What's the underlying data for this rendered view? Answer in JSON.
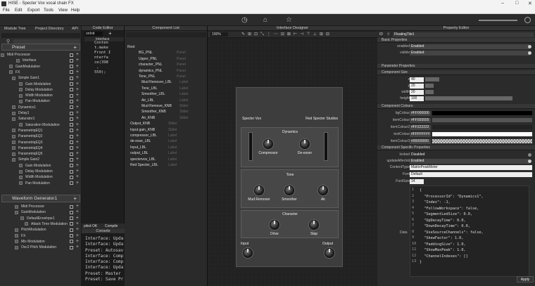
{
  "window": {
    "title": "HISE - Specter Vox vocal chain FX"
  },
  "menu": [
    "File",
    "Edit",
    "Export",
    "Tools",
    "View",
    "Help"
  ],
  "left": {
    "tabs": [
      "Module Tree",
      "Project Directory",
      "API"
    ],
    "preset_label": "Preset",
    "rows": [
      {
        "label": "Midi Processor",
        "indent": 10
      },
      {
        "label": "Interface",
        "indent": 32
      },
      {
        "label": "GainModulation",
        "indent": 22
      },
      {
        "label": "FX",
        "indent": 22
      },
      {
        "label": "Simple Gain1",
        "indent": 26
      },
      {
        "label": "Gain Modulation",
        "indent": 36
      },
      {
        "label": "Delay Modulation",
        "indent": 36
      },
      {
        "label": "Width Modulation",
        "indent": 36
      },
      {
        "label": "Pan Modulation",
        "indent": 36
      },
      {
        "label": "Dynamics1",
        "indent": 26
      },
      {
        "label": "Delay1",
        "indent": 26
      },
      {
        "label": "Saturator1",
        "indent": 26
      },
      {
        "label": "Saturation Modulation",
        "indent": 36
      },
      {
        "label": "ParametriqEQ1",
        "indent": 26
      },
      {
        "label": "ParametriqEQ2",
        "indent": 26
      },
      {
        "label": "ParametriqEQ3",
        "indent": 26
      },
      {
        "label": "ParametriqEQ4",
        "indent": 26
      },
      {
        "label": "ParametriqEQ5",
        "indent": 26
      },
      {
        "label": "Simple Gain2",
        "indent": 26
      },
      {
        "label": "Gain Modulation",
        "indent": 36
      },
      {
        "label": "Delay Modulation",
        "indent": 36
      },
      {
        "label": "Width Modulation",
        "indent": 36
      },
      {
        "label": "Pan Modulation",
        "indent": 36
      }
    ],
    "waveform_label": "Waveform Generator1",
    "rows2": [
      {
        "label": "Midi Processor",
        "indent": 30
      },
      {
        "label": "GainModulation",
        "indent": 30
      },
      {
        "label": "DefaultEnvelope1",
        "indent": 38
      },
      {
        "label": "Attack Time Modulation",
        "indent": 44
      },
      {
        "label": "PitchModulation",
        "indent": 30
      },
      {
        "label": "FX",
        "indent": 30
      },
      {
        "label": "Mix Modulation",
        "indent": 30
      },
      {
        "label": "Osc2 Pitch Modulation",
        "indent": 30
      }
    ]
  },
  "code": {
    "header": "Code Editor",
    "tab": "onInit",
    "file": "Interface",
    "lines": [
      "Conten",
      "t.make",
      "Front I",
      "nterfa",
      "ce(398",
      " , ",
      "550);"
    ],
    "status": "piled OK",
    "compile": "Compile"
  },
  "console": {
    "header": "Console",
    "lines": [
      "Interface: Upda",
      "Interface: Upda",
      "Preset: Autosav",
      "Interface: Comp",
      "Interface: Comp",
      "Interface: Upda",
      "Preset: Master",
      "Preset: Save Pr"
    ]
  },
  "components": {
    "header": "Component List",
    "rows": [
      {
        "name": "Root",
        "type": ""
      },
      {
        "name": "BG_PNL",
        "type": "Panel"
      },
      {
        "name": "Upper_PNL",
        "type": "Panel"
      },
      {
        "name": "character_PNL",
        "type": "Panel"
      },
      {
        "name": "dynamics_PNL",
        "type": "Panel"
      },
      {
        "name": "Tone_PNL",
        "type": "Panel"
      },
      {
        "name": "Mud Remover_LBL",
        "type": "Label"
      },
      {
        "name": "Tone_LBL",
        "type": "Label"
      },
      {
        "name": "Smoother_LBL",
        "type": "Label"
      },
      {
        "name": "Air_LBL",
        "type": "Label"
      },
      {
        "name": "Mud Remove_KNB",
        "type": "Slider"
      },
      {
        "name": "Smoother_KNB",
        "type": "Slider"
      },
      {
        "name": "Air_KNB",
        "type": "Slider"
      },
      {
        "name": "Output_KNB",
        "type": "Slider"
      },
      {
        "name": "Input gain_KNB",
        "type": "Slider"
      },
      {
        "name": "compressor_LBL",
        "type": "Label"
      },
      {
        "name": "de-esse_LBL",
        "type": "Label"
      },
      {
        "name": "Input_LBL",
        "type": "Label"
      },
      {
        "name": "output_LBL",
        "type": "Label"
      },
      {
        "name": "spectervox_LBL",
        "type": "Label"
      },
      {
        "name": "Red Specter_LBL",
        "type": "Label"
      }
    ]
  },
  "designer": {
    "header": "Interface Designer",
    "zoom": "100%",
    "plugin": {
      "brand_left": "Specter Vox",
      "brand_right": "Red Specter Studios",
      "dynamics": "Dynamics",
      "compressor": "Compressor",
      "deesser": "De-esser",
      "tone": "Tone",
      "mud": "Mud Remover",
      "smoother": "Smoother",
      "air": "Air",
      "character": "Character",
      "drive": "Drive",
      "slap": "Slap",
      "input": "Input",
      "output": "Output"
    }
  },
  "props": {
    "header": "Property Editor",
    "id_label": "ID",
    "id_value": "FloatingTile1",
    "basic_hdr": "Basic Properties",
    "enabled_label": "enabled",
    "enabled": "Enabled",
    "visible_label": "visible",
    "visible": "Enabled",
    "param_hdr": "Parameter Properties",
    "size_hdr": "Component Size",
    "x": "40",
    "y": "20",
    "width": "20",
    "height": "100",
    "colours_hdr": "Component Colours",
    "bg": "#FF000000",
    "ic1": "#FF555555",
    "ic2": "#FF222222",
    "tc": "#FFFFFFFF",
    "ic3": "#00000000",
    "specific_hdr": "Component Specific Properties",
    "locked": "Disabled",
    "update": "Enabled",
    "ctype": "MatrixPeakMeter",
    "font": "Default",
    "fsize": "14",
    "json_lines": [
      "{",
      "  \"ProcessorId\": \"Dynamics1\",",
      "  \"Index\": -1,",
      "  \"FollowWorkspace\": false,",
      "  \"SegmentLedSize\": 0.0,",
      "  \"UpDecayTime\": 0.0,",
      "  \"DownDecayTime\": 0.0,",
      "  \"UseSourceChannels\": false,",
      "  \"SkewFactor\": 1.0,",
      "  \"PaddingSize\": 1.0,",
      "  \"ShowMaxPeak\": 1.0,",
      "  \"ChannelIndexes\": []",
      "}"
    ],
    "data_label": "Data",
    "apply": "Apply"
  }
}
